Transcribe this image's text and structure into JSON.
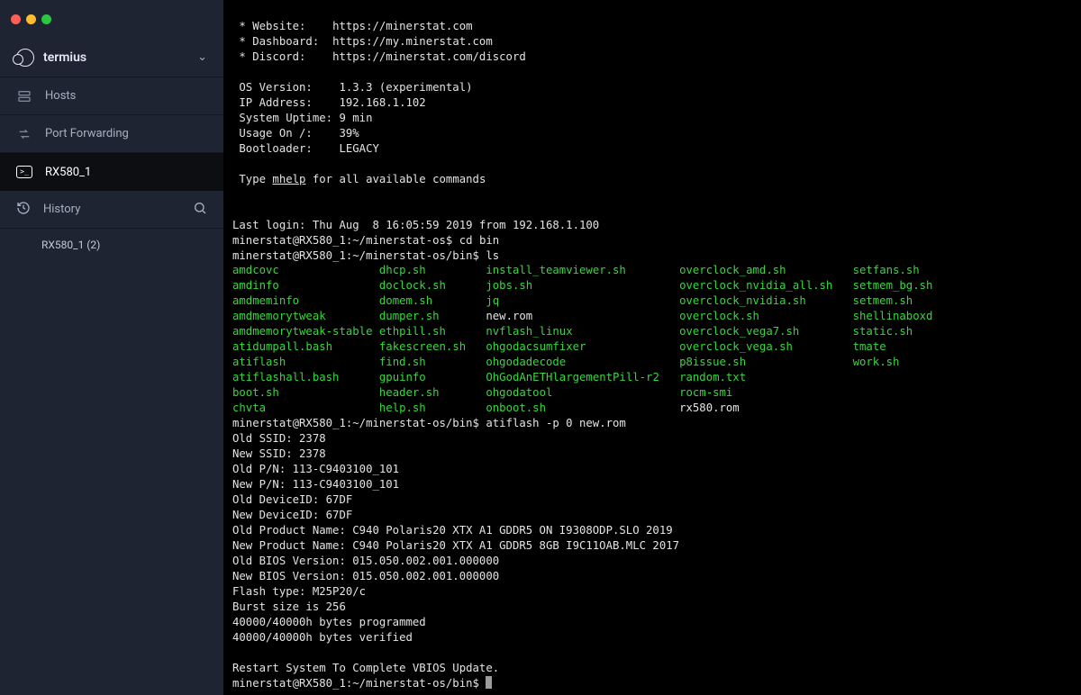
{
  "app": {
    "name": "termius"
  },
  "sidebar": {
    "hosts": "Hosts",
    "portForwarding": "Port Forwarding",
    "activeTab": "RX580_1",
    "history": "History",
    "recent": "RX580_1 (2)"
  },
  "term": {
    "header": {
      "website_k": " * Website:    ",
      "website_v": "https://minerstat.com",
      "dashboard_k": " * Dashboard:  ",
      "dashboard_v": "https://my.minerstat.com",
      "discord_k": " * Discord:    ",
      "discord_v": "https://minerstat.com/discord"
    },
    "sys": {
      "os": " OS Version:    1.3.3 (experimental)",
      "ip": " IP Address:    192.168.1.102",
      "uptime": " System Uptime: 9 min",
      "usage": " Usage On /:    39%",
      "boot": " Bootloader:    LEGACY"
    },
    "help_pre": " Type ",
    "help_cmd": "mhelp",
    "help_post": " for all available commands",
    "lastlogin": "Last login: Thu Aug  8 16:05:59 2019 from 192.168.1.100",
    "p1_host": "minerstat@RX580_1:~/minerstat-os",
    "p1_cmd": "cd bin",
    "p2_host": "minerstat@RX580_1:~/minerstat-os/bin",
    "p2_cmd": "ls",
    "ls": {
      "r0": {
        "c0": "amdcovc",
        "c1": "dhcp.sh",
        "c2": "install_teamviewer.sh",
        "c3": "overclock_amd.sh",
        "c4": "setfans.sh"
      },
      "r1": {
        "c0": "amdinfo",
        "c1": "doclock.sh",
        "c2": "jobs.sh",
        "c3": "overclock_nvidia_all.sh",
        "c4": "setmem_bg.sh"
      },
      "r2": {
        "c0": "amdmeminfo",
        "c1": "domem.sh",
        "c2": "jq",
        "c3": "overclock_nvidia.sh",
        "c4": "setmem.sh"
      },
      "r3": {
        "c0": "amdmemorytweak",
        "c1": "dumper.sh",
        "c2w": "new.rom",
        "c3": "overclock.sh",
        "c4": "shellinaboxd"
      },
      "r4": {
        "c0": "amdmemorytweak-stable",
        "c1": "ethpill.sh",
        "c2": "nvflash_linux",
        "c3": "overclock_vega7.sh",
        "c4": "static.sh"
      },
      "r5": {
        "c0": "atidumpall.bash",
        "c1": "fakescreen.sh",
        "c2": "ohgodacsumfixer",
        "c3": "overclock_vega.sh",
        "c4": "tmate"
      },
      "r6": {
        "c0": "atiflash",
        "c1": "find.sh",
        "c2": "ohgodadecode",
        "c3": "p8issue.sh",
        "c4": "work.sh"
      },
      "r7": {
        "c0": "atiflashall.bash",
        "c1": "gpuinfo",
        "c2": "OhGodAnETHlargementPill-r2",
        "c3": "random.txt",
        "c4": ""
      },
      "r8": {
        "c0": "boot.sh",
        "c1": "header.sh",
        "c2": "ohgodatool",
        "c3": "rocm-smi",
        "c4": ""
      },
      "r9": {
        "c0": "chvta",
        "c1": "help.sh",
        "c2": "onboot.sh",
        "c3w": "rx580.rom",
        "c4": ""
      }
    },
    "p3_cmd": "atiflash -p 0 new.rom",
    "flash": {
      "l0": "Old SSID: 2378",
      "l1": "New SSID: 2378",
      "l2": "Old P/N: 113-C9403100_101",
      "l3": "New P/N: 113-C9403100_101",
      "l4": "Old DeviceID: 67DF",
      "l5": "New DeviceID: 67DF",
      "l6": "Old Product Name: C940 Polaris20 XTX A1 GDDR5 ON I9308ODP.SLO 2019",
      "l7": "New Product Name: C940 Polaris20 XTX A1 GDDR5 8GB I9C11OAB.MLC 2017",
      "l8": "Old BIOS Version: 015.050.002.001.000000",
      "l9": "New BIOS Version: 015.050.002.001.000000",
      "l10": "Flash type: M25P20/c",
      "l11": "Burst size is 256",
      "l12": "40000/40000h bytes programmed",
      "l13": "40000/40000h bytes verified",
      "l14": "",
      "l15": "Restart System To Complete VBIOS Update."
    }
  }
}
